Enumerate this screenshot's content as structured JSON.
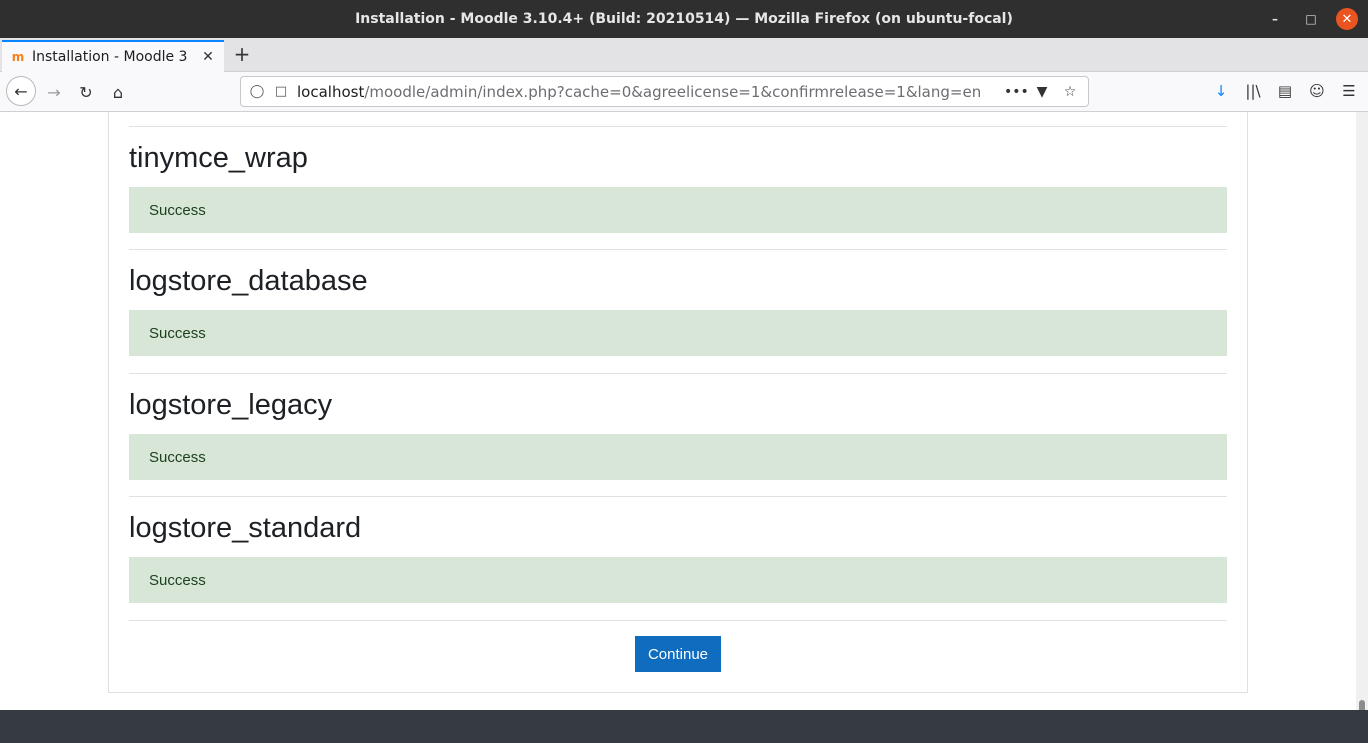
{
  "window": {
    "title": "Installation - Moodle 3.10.4+ (Build: 20210514) — Mozilla Firefox (on ubuntu-focal)"
  },
  "tabs": [
    {
      "title": "Installation - Moodle 3",
      "favicon": "moodle-icon"
    }
  ],
  "urlbar": {
    "host": "localhost",
    "path": "/moodle/admin/index.php?cache=0&agreelicense=1&confirmrelease=1&lang=en"
  },
  "colors": {
    "accent": "#0f6cbf",
    "success_bg": "#d7e6d7",
    "success_text": "#1c3f1c",
    "tab_highlight": "#0a84ff"
  },
  "sections": [
    {
      "heading": "tinymce_wrap",
      "status": "Success"
    },
    {
      "heading": "logstore_database",
      "status": "Success"
    },
    {
      "heading": "logstore_legacy",
      "status": "Success"
    },
    {
      "heading": "logstore_standard",
      "status": "Success"
    }
  ],
  "actions": {
    "continue_label": "Continue"
  }
}
